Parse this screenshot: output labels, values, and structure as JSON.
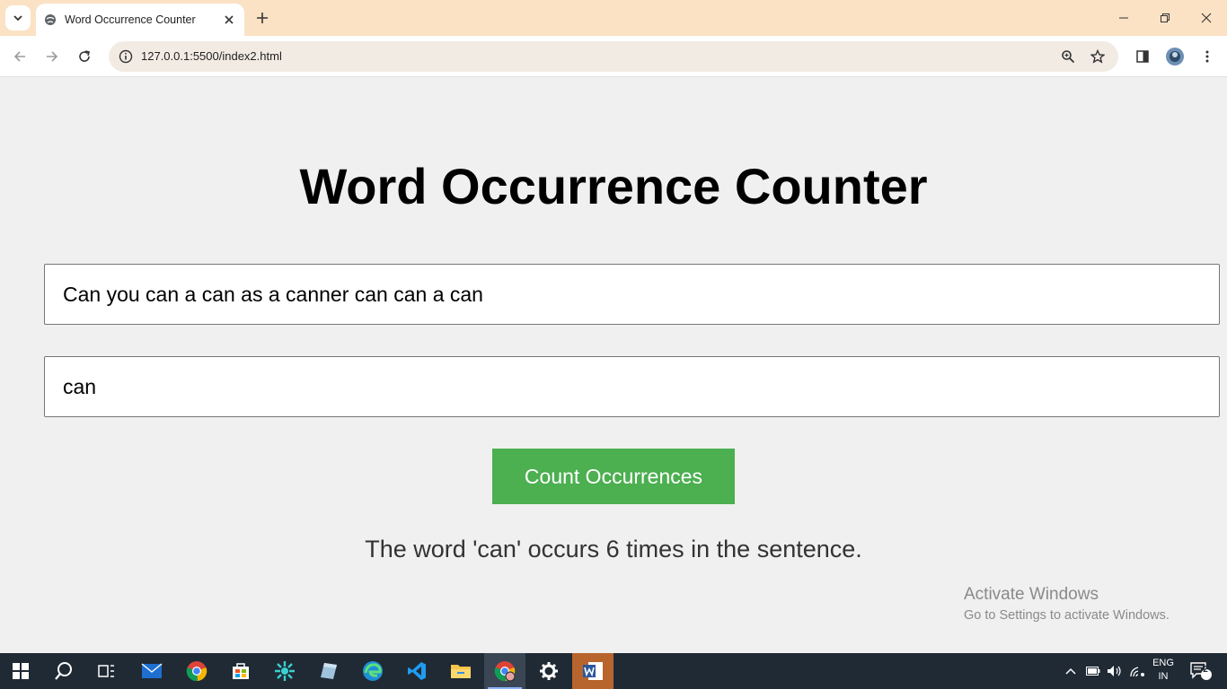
{
  "browser": {
    "tab": {
      "title": "Word Occurrence Counter"
    },
    "url": "127.0.0.1:5500/index2.html"
  },
  "app": {
    "title": "Word Occurrence Counter",
    "sentence_value": "Can you can a can as a canner can can a can",
    "word_value": "can",
    "button_label": "Count Occurrences",
    "result_text": "The word 'can' occurs 6 times in the sentence.",
    "button_color": "#4caf50"
  },
  "watermark": {
    "line1": "Activate Windows",
    "line2": "Go to Settings to activate Windows."
  },
  "taskbar": {
    "apps": [
      "start-icon",
      "search-icon",
      "task-view-icon",
      "mail-icon",
      "chrome-icon",
      "store-icon",
      "app-icon",
      "notepad-icon",
      "edge-icon",
      "vscode-icon",
      "file-explorer-icon",
      "chrome-active-icon",
      "settings-icon",
      "word-icon"
    ],
    "lang_line1": "ENG",
    "lang_line2": "IN",
    "notification_count": "2"
  }
}
